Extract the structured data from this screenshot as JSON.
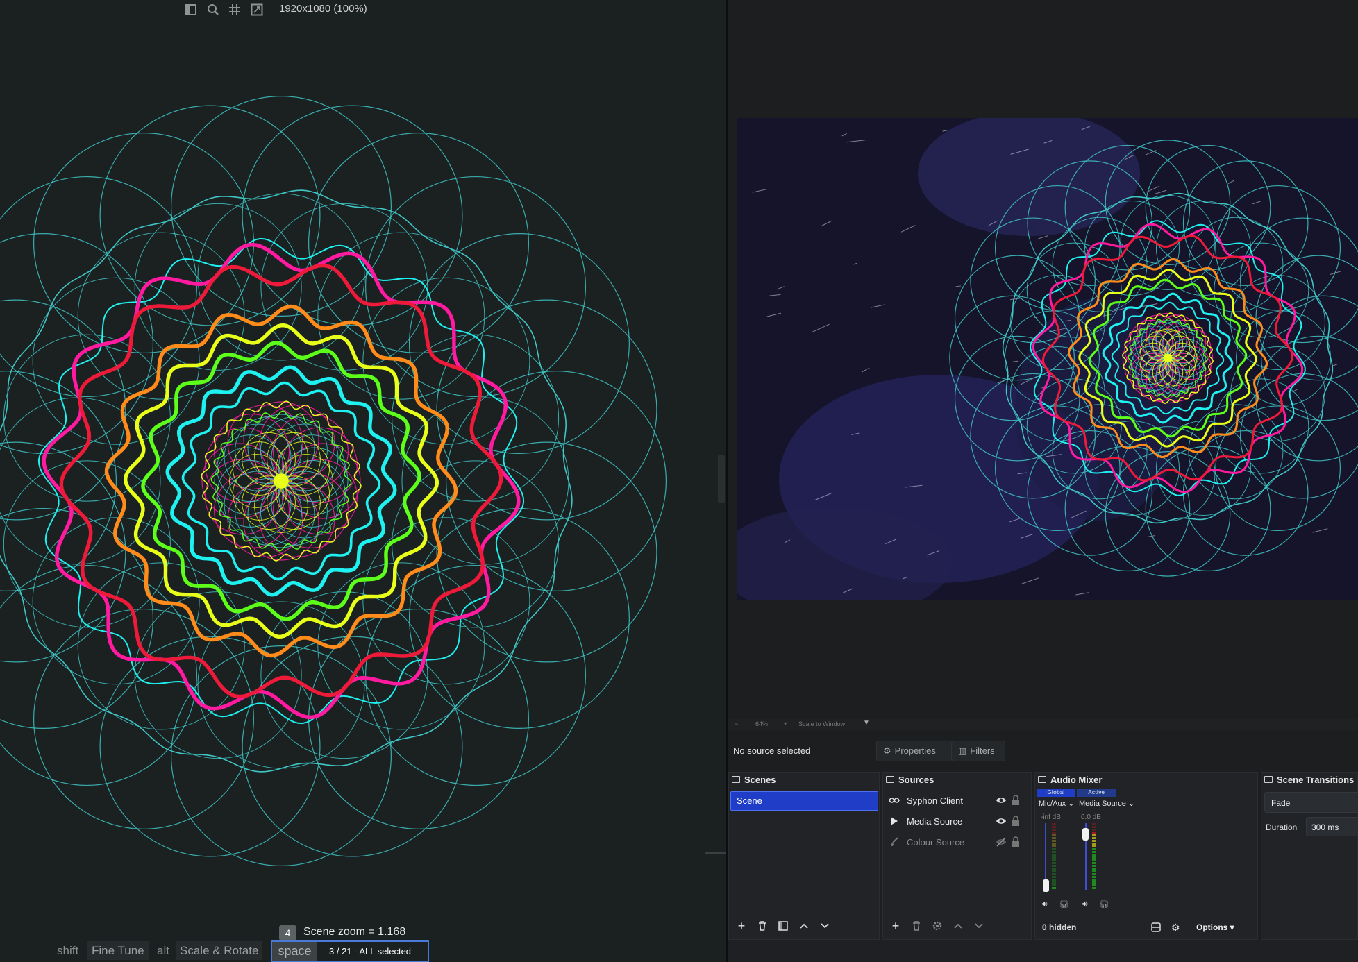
{
  "editor": {
    "toolbar_icons": [
      "sidebar-icon",
      "search-icon",
      "grid-icon",
      "fit-screen-icon"
    ],
    "resolution": "1920x1080 (100%)",
    "zoom_badge": "4",
    "zoom_text": "Scene zoom = 1.168",
    "keys": {
      "shift": "shift",
      "fine_tune": "Fine Tune",
      "alt": "alt",
      "scale_rotate": "Scale & Rotate",
      "space": "space"
    },
    "selection_text": "3 / 21 - ALL selected",
    "colors": {
      "background": "#1b2021",
      "teal": "#3fc6c6",
      "cyan": "#1ff0f0",
      "magenta": "#ff1aa0",
      "red": "#ee1a3a",
      "orange": "#ff8c1a",
      "yellow": "#e8ff1a",
      "green": "#5dff1a"
    }
  },
  "obs": {
    "zoom": {
      "minus": "−",
      "level": "64%",
      "plus": "+",
      "mode": "Scale to Window"
    },
    "context": {
      "no_source": "No source selected",
      "properties": "Properties",
      "filters": "Filters"
    },
    "scenes": {
      "title": "Scenes",
      "items": [
        "Scene"
      ]
    },
    "sources": {
      "title": "Sources",
      "items": [
        {
          "name": "Syphon Client",
          "icon": "syphon-icon",
          "visible": true
        },
        {
          "name": "Media Source",
          "icon": "play-icon",
          "visible": true
        },
        {
          "name": "Colour Source",
          "icon": "brush-icon",
          "visible": false
        }
      ]
    },
    "mixer": {
      "title": "Audio Mixer",
      "channels": [
        {
          "tag": "Global",
          "label": "Mic/Aux",
          "db": "-inf dB",
          "level": 0.05
        },
        {
          "tag": "Active",
          "label": "Media Source",
          "db": "0.0 dB",
          "level": 0.9
        }
      ],
      "hidden": "0 hidden",
      "options": "Options"
    },
    "transitions": {
      "title": "Scene Transitions",
      "type": "Fade",
      "duration_label": "Duration",
      "duration_value": "300 ms"
    },
    "colors": {
      "accent": "#1f3dc7",
      "panel": "#212326"
    }
  }
}
